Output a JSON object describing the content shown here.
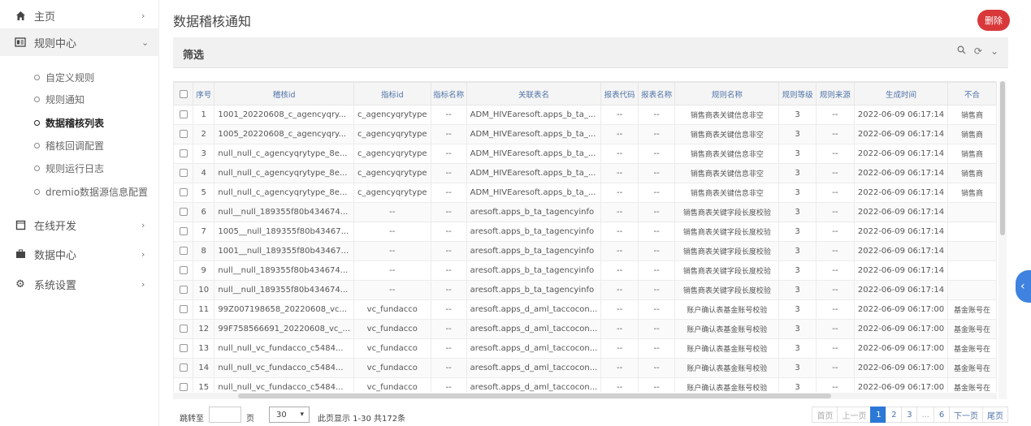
{
  "sidebar": {
    "home": {
      "label": "主页",
      "icon": "home-icon"
    },
    "rules_center": {
      "label": "规则中心",
      "icon": "panel-icon"
    },
    "rules_children": [
      {
        "label": "自定义规则"
      },
      {
        "label": "规则通知"
      },
      {
        "label": "数据稽核列表"
      },
      {
        "label": "稽核回调配置"
      },
      {
        "label": "规则运行日志"
      },
      {
        "label": "dremio数据源信息配置"
      }
    ],
    "online_dev": {
      "label": "在线开发",
      "icon": "window-icon"
    },
    "data_center": {
      "label": "数据中心",
      "icon": "briefcase-icon"
    },
    "settings": {
      "label": "系统设置",
      "icon": "gear-icon"
    }
  },
  "page": {
    "title": "数据稽核通知",
    "delete_label": "删除"
  },
  "filter": {
    "title": "筛选"
  },
  "table": {
    "headers": [
      "序号",
      "稽核id",
      "指标id",
      "指标名称",
      "关联表名",
      "报表代码",
      "报表名称",
      "规则名称",
      "规则等级",
      "规则来源",
      "生成时间",
      "不合"
    ],
    "rows": [
      [
        "1",
        "1001_20220608_c_agencyqry...",
        "c_agencyqrytype",
        "--",
        "ADM_HIVEaresoft.apps_b_ta_...",
        "--",
        "--",
        "销售商表关键信息非空",
        "3",
        "--",
        "2022-06-09 06:17:14",
        "销售商"
      ],
      [
        "2",
        "1005_20220608_c_agencyqry...",
        "c_agencyqrytype",
        "--",
        "ADM_HIVEaresoft.apps_b_ta_...",
        "--",
        "--",
        "销售商表关键信息非空",
        "3",
        "--",
        "2022-06-09 06:17:14",
        "销售商"
      ],
      [
        "3",
        "null_null_c_agencyqrytype_8e...",
        "c_agencyqrytype",
        "--",
        "ADM_HIVEaresoft.apps_b_ta_...",
        "--",
        "--",
        "销售商表关键信息非空",
        "3",
        "--",
        "2022-06-09 06:17:14",
        "销售商"
      ],
      [
        "4",
        "null_null_c_agencyqrytype_8e...",
        "c_agencyqrytype",
        "--",
        "ADM_HIVEaresoft.apps_b_ta_...",
        "--",
        "--",
        "销售商表关键信息非空",
        "3",
        "--",
        "2022-06-09 06:17:14",
        "销售商"
      ],
      [
        "5",
        "null_null_c_agencyqrytype_8e...",
        "c_agencyqrytype",
        "--",
        "ADM_HIVEaresoft.apps_b_ta_...",
        "--",
        "--",
        "销售商表关键信息非空",
        "3",
        "--",
        "2022-06-09 06:17:14",
        "销售商"
      ],
      [
        "6",
        "null__null_189355f80b434674...",
        "--",
        "--",
        "aresoft.apps_b_ta_tagencyinfo",
        "--",
        "--",
        "销售商表关键字段长度校验",
        "3",
        "--",
        "2022-06-09 06:17:14",
        ""
      ],
      [
        "7",
        "1005__null_189355f80b43467...",
        "--",
        "--",
        "aresoft.apps_b_ta_tagencyinfo",
        "--",
        "--",
        "销售商表关键字段长度校验",
        "3",
        "--",
        "2022-06-09 06:17:14",
        ""
      ],
      [
        "8",
        "1001__null_189355f80b43467...",
        "--",
        "--",
        "aresoft.apps_b_ta_tagencyinfo",
        "--",
        "--",
        "销售商表关键字段长度校验",
        "3",
        "--",
        "2022-06-09 06:17:14",
        ""
      ],
      [
        "9",
        "null__null_189355f80b434674...",
        "--",
        "--",
        "aresoft.apps_b_ta_tagencyinfo",
        "--",
        "--",
        "销售商表关键字段长度校验",
        "3",
        "--",
        "2022-06-09 06:17:14",
        ""
      ],
      [
        "10",
        "null__null_189355f80b434674...",
        "--",
        "--",
        "aresoft.apps_b_ta_tagencyinfo",
        "--",
        "--",
        "销售商表关键字段长度校验",
        "3",
        "--",
        "2022-06-09 06:17:14",
        ""
      ],
      [
        "11",
        "99Z007198658_20220608_vc...",
        "vc_fundacco",
        "--",
        "aresoft.apps_d_aml_taccocon...",
        "--",
        "--",
        "账户确认表基金账号校验",
        "3",
        "--",
        "2022-06-09 06:17:00",
        "基金账号在"
      ],
      [
        "12",
        "99F758566691_20220608_vc_...",
        "vc_fundacco",
        "--",
        "aresoft.apps_d_aml_taccocon...",
        "--",
        "--",
        "账户确认表基金账号校验",
        "3",
        "--",
        "2022-06-09 06:17:00",
        "基金账号在"
      ],
      [
        "13",
        "null_null_vc_fundacco_c5484...",
        "vc_fundacco",
        "--",
        "aresoft.apps_d_aml_taccocon...",
        "--",
        "--",
        "账户确认表基金账号校验",
        "3",
        "--",
        "2022-06-09 06:17:00",
        "基金账号在"
      ],
      [
        "14",
        "null_null_vc_fundacco_c5484...",
        "vc_fundacco",
        "--",
        "aresoft.apps_d_aml_taccocon...",
        "--",
        "--",
        "账户确认表基金账号校验",
        "3",
        "--",
        "2022-06-09 06:17:00",
        "基金账号在"
      ],
      [
        "15",
        "null_null_vc_fundacco_c5484...",
        "vc_fundacco",
        "--",
        "aresoft.apps_d_aml_taccocon...",
        "--",
        "--",
        "账户确认表基金账号校验",
        "3",
        "--",
        "2022-06-09 06:17:00",
        "基金账号在"
      ]
    ]
  },
  "pager": {
    "jump_label": "跳转至",
    "page_label": "页",
    "page_size": "30",
    "info": "此页显示 1-30 共172条",
    "buttons": [
      "首页",
      "上一页",
      "1",
      "2",
      "3",
      "...",
      "6",
      "下一页",
      "尾页"
    ],
    "current": "1"
  }
}
